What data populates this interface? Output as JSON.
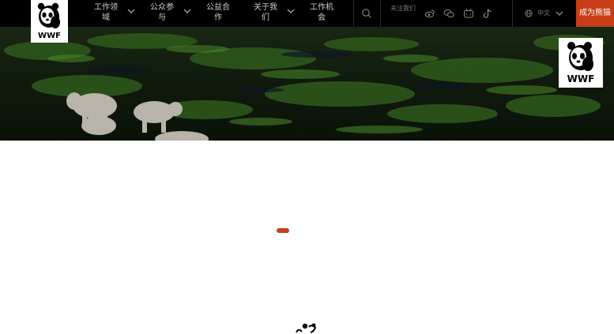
{
  "brand": {
    "logo_text": "WWF",
    "accent_color": "#c63d17"
  },
  "nav": {
    "items": [
      {
        "label": "工作领域"
      },
      {
        "label": "公众参与"
      },
      {
        "label": "公益合作"
      },
      {
        "label": "关于我们"
      },
      {
        "label": "工作机会"
      }
    ]
  },
  "header": {
    "search_icon": "search-icon",
    "follow_label": "关注我们",
    "social_icons": [
      "weibo-icon",
      "wechat-icon",
      "bilibili-icon",
      "tiktok-icon"
    ],
    "language": "中文",
    "cta_label": "成为熊猫客"
  },
  "hero": {
    "image": "aerial-wetland-elephants"
  },
  "loading": {
    "indicator_color": "#c2411b"
  }
}
